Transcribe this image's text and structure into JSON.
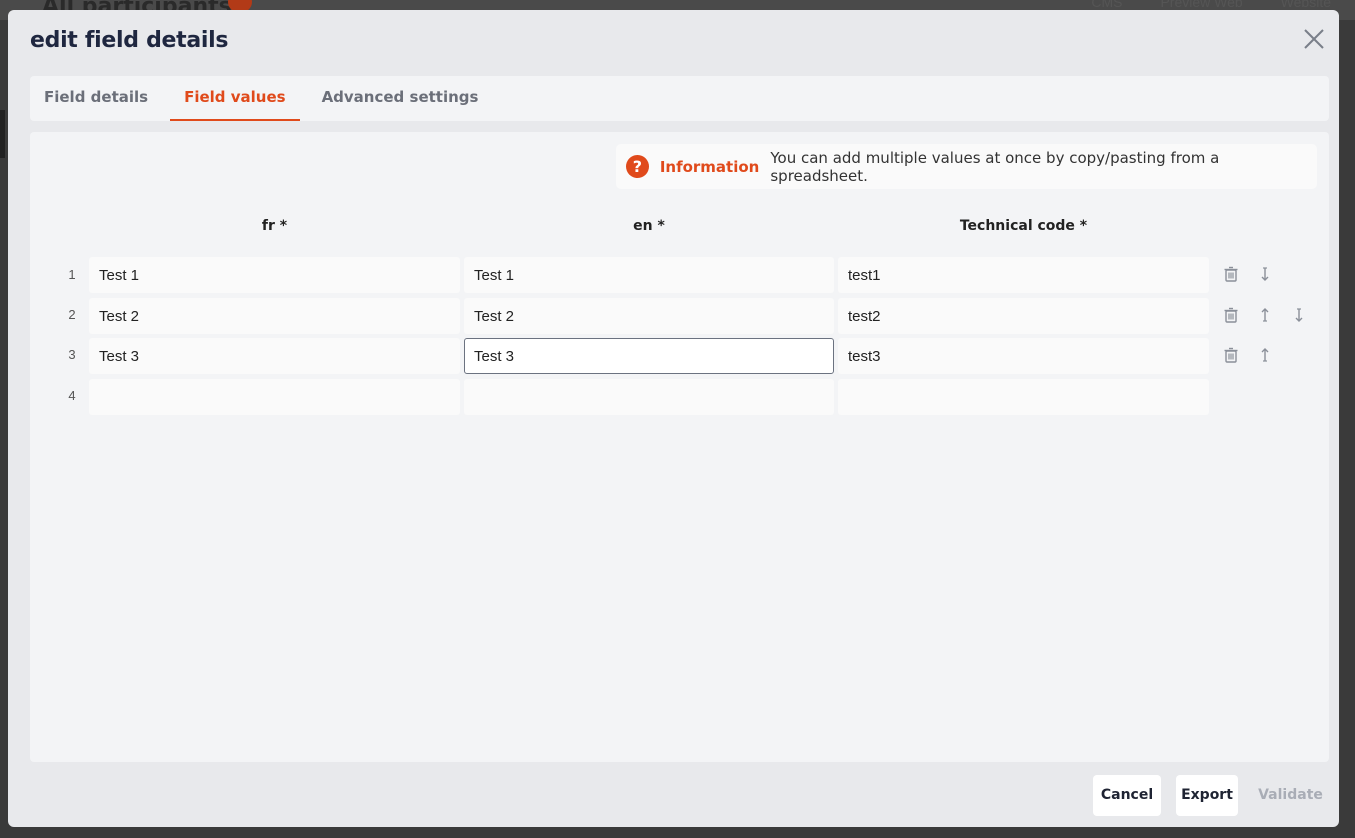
{
  "background": {
    "title": "All participants",
    "links": [
      "CMS",
      "Preview Web",
      "Website"
    ]
  },
  "modal": {
    "title": "edit field details",
    "close_icon": "close-icon"
  },
  "tabs": [
    {
      "label": "Field details",
      "active": false
    },
    {
      "label": "Field values",
      "active": true
    },
    {
      "label": "Advanced settings",
      "active": false
    }
  ],
  "info": {
    "icon": "?",
    "title": "Information",
    "text": "You can add multiple values at once by copy/pasting from a spreadsheet."
  },
  "columns": [
    "fr *",
    "en *",
    "Technical code *"
  ],
  "rows": [
    {
      "num": "1",
      "fr": "Test 1",
      "en": "Test 1",
      "code": "test1"
    },
    {
      "num": "2",
      "fr": "Test 2",
      "en": "Test 2",
      "code": "test2"
    },
    {
      "num": "3",
      "fr": "Test 3",
      "en": "Test 3",
      "code": "test3"
    },
    {
      "num": "4",
      "fr": "",
      "en": "",
      "code": ""
    }
  ],
  "footer": {
    "cancel": "Cancel",
    "export": "Export",
    "validate": "Validate"
  },
  "colors": {
    "accent": "#e04a1b",
    "modal_bg": "#e8e9ec",
    "panel_bg": "#f3f4f6",
    "disabled_text": "#a9adb6"
  }
}
